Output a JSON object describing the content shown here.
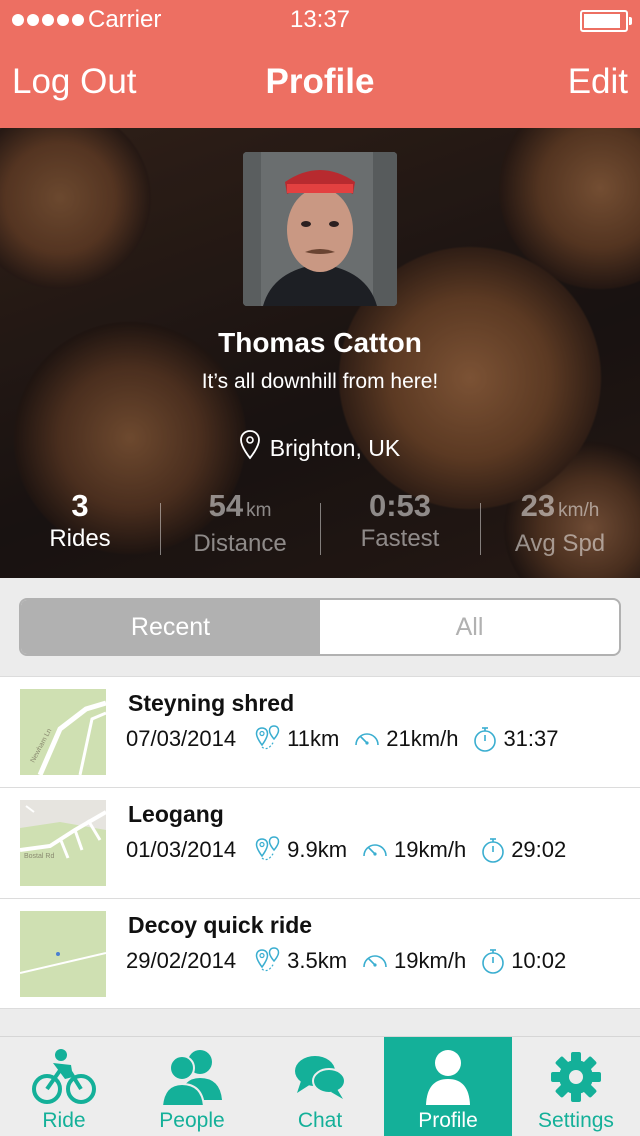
{
  "status": {
    "carrier": "Carrier",
    "time": "13:37"
  },
  "nav": {
    "left": "Log Out",
    "title": "Profile",
    "right": "Edit"
  },
  "profile": {
    "name": "Thomas Catton",
    "bio": "It’s all downhill from here!",
    "location": "Brighton, UK"
  },
  "stats": [
    {
      "value": "3",
      "unit": "",
      "label": "Rides"
    },
    {
      "value": "54",
      "unit": "km",
      "label": "Distance"
    },
    {
      "value": "0:53",
      "unit": "",
      "label": "Fastest"
    },
    {
      "value": "23",
      "unit": "km/h",
      "label": "Avg Spd"
    }
  ],
  "segment": {
    "recent": "Recent",
    "all": "All",
    "selected": "Recent"
  },
  "rides": [
    {
      "title": "Steyning shred",
      "date": "07/03/2014",
      "distance": "11km",
      "speed": "21km/h",
      "time": "31:37",
      "map_label": "Newham Ln"
    },
    {
      "title": "Leogang",
      "date": "01/03/2014",
      "distance": "9.9km",
      "speed": "19km/h",
      "time": "29:02",
      "map_label": "Bostal Rd"
    },
    {
      "title": "Decoy quick ride",
      "date": "29/02/2014",
      "distance": "3.5km",
      "speed": "19km/h",
      "time": "10:02",
      "map_label": ""
    }
  ],
  "tabs": [
    {
      "label": "Ride",
      "icon": "bike-icon"
    },
    {
      "label": "People",
      "icon": "people-icon"
    },
    {
      "label": "Chat",
      "icon": "chat-icon"
    },
    {
      "label": "Profile",
      "icon": "profile-icon"
    },
    {
      "label": "Settings",
      "icon": "gear-icon"
    }
  ],
  "active_tab": "Profile",
  "colors": {
    "header": "#ed6f62",
    "accent": "#14b099",
    "segment_grey": "#b1b1b1"
  }
}
